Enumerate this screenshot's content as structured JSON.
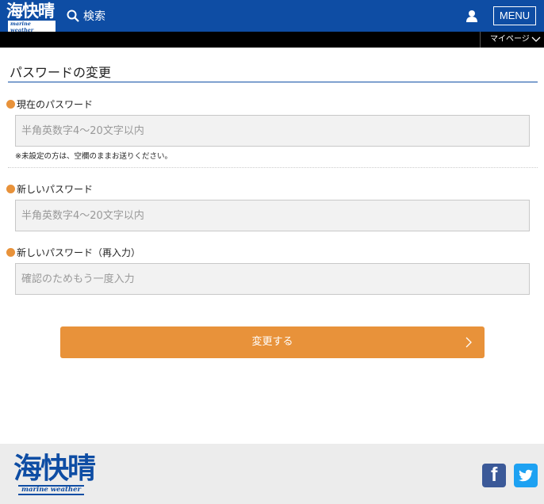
{
  "header": {
    "logo_text": "海快晴",
    "logo_sub": "marine weather",
    "search_label": "検索",
    "menu_label": "MENU"
  },
  "subbar": {
    "mypage_label": "マイページ"
  },
  "main": {
    "title": "パスワードの変更",
    "current_password": {
      "label": "現在のパスワード",
      "placeholder": "半角英数字4～20文字以内",
      "note": "※未設定の方は、空欄のままお送りください。"
    },
    "new_password": {
      "label": "新しいパスワード",
      "placeholder": "半角英数字4～20文字以内"
    },
    "confirm_password": {
      "label": "新しいパスワード（再入力）",
      "placeholder": "確認のためもう一度入力"
    },
    "submit_label": "変更する"
  },
  "footer": {
    "logo_text": "海快晴",
    "logo_sub": "marine weather"
  },
  "colors": {
    "brand_blue": "#0e4da4",
    "accent_orange": "#e8923a",
    "facebook": "#3b5998",
    "twitter": "#1da1f2"
  },
  "icons": [
    "search-icon",
    "user-icon",
    "chevron-down-icon",
    "chevron-right-icon",
    "facebook-icon",
    "twitter-icon"
  ]
}
